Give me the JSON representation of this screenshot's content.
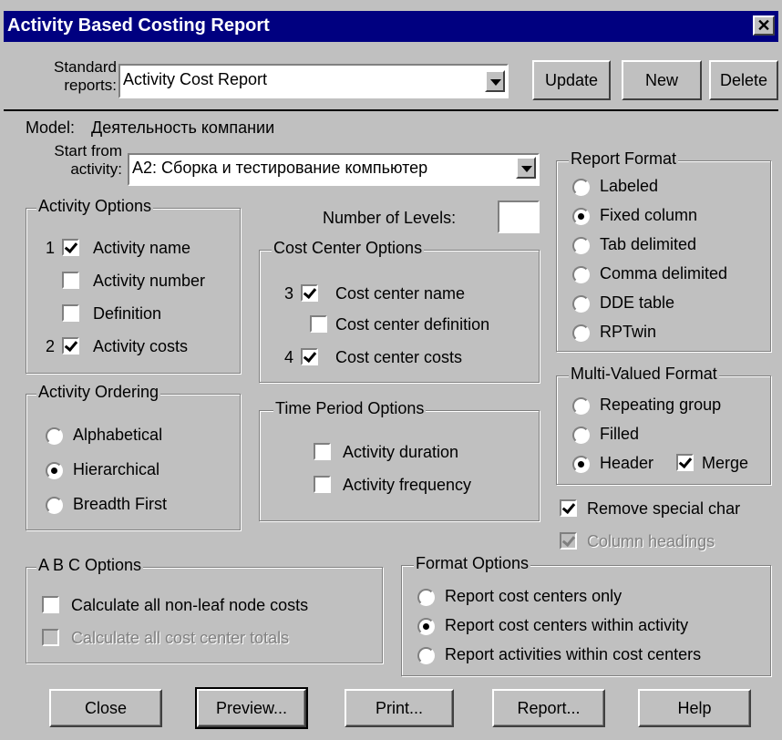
{
  "window": {
    "title": "Activity Based Costing Report",
    "close_label": "✕"
  },
  "header": {
    "standard_label_1": "Standard",
    "standard_label_2": "reports:",
    "report_value": "Activity Cost Report",
    "update": "Update",
    "new": "New",
    "delete": "Delete"
  },
  "model": {
    "label": "Model:",
    "value": "Деятельность компании"
  },
  "start": {
    "label_1": "Start from",
    "label_2": "activity:",
    "value": "A2:  Сборка и тестирование компьютер"
  },
  "levels": {
    "label": "Number of Levels:",
    "value": ""
  },
  "activity_options": {
    "title": "Activity Options",
    "items": [
      {
        "num": "1",
        "label": "Activity name",
        "checked": true
      },
      {
        "num": "",
        "label": "Activity number",
        "checked": false
      },
      {
        "num": "",
        "label": "Definition",
        "checked": false
      },
      {
        "num": "2",
        "label": "Activity costs",
        "checked": true
      }
    ]
  },
  "cost_center_options": {
    "title": "Cost Center Options",
    "items": [
      {
        "num": "3",
        "label": "Cost center name",
        "checked": true
      },
      {
        "num": "",
        "label": "Cost center definition",
        "checked": false
      },
      {
        "num": "4",
        "label": "Cost center costs",
        "checked": true
      }
    ]
  },
  "activity_ordering": {
    "title": "Activity Ordering",
    "items": [
      {
        "label": "Alphabetical",
        "selected": false
      },
      {
        "label": "Hierarchical",
        "selected": true
      },
      {
        "label": "Breadth First",
        "selected": false
      }
    ]
  },
  "time_period_options": {
    "title": "Time Period Options",
    "items": [
      {
        "label": "Activity duration",
        "checked": false
      },
      {
        "label": "Activity frequency",
        "checked": false
      }
    ]
  },
  "report_format": {
    "title": "Report Format",
    "items": [
      {
        "label": "Labeled",
        "selected": false
      },
      {
        "label": "Fixed column",
        "selected": true
      },
      {
        "label": "Tab delimited",
        "selected": false
      },
      {
        "label": "Comma delimited",
        "selected": false
      },
      {
        "label": "DDE table",
        "selected": false
      },
      {
        "label": "RPTwin",
        "selected": false
      }
    ]
  },
  "multi_valued_format": {
    "title": "Multi-Valued Format",
    "items": [
      {
        "label": "Repeating group",
        "selected": false
      },
      {
        "label": "Filled",
        "selected": false
      },
      {
        "label": "Header",
        "selected": true
      }
    ],
    "merge": {
      "label": "Merge",
      "checked": true
    }
  },
  "remove_special": {
    "label": "Remove special char",
    "checked": true
  },
  "column_headings": {
    "label": "Column headings",
    "checked": true,
    "disabled": true
  },
  "abc_options": {
    "title": "A B C  Options",
    "items": [
      {
        "label": "Calculate all non-leaf node costs",
        "checked": false,
        "disabled": false
      },
      {
        "label": "Calculate all cost center totals",
        "checked": false,
        "disabled": true
      }
    ]
  },
  "format_options": {
    "title": "Format Options",
    "items": [
      {
        "label": "Report cost centers only",
        "selected": false
      },
      {
        "label": "Report cost centers within activity",
        "selected": true
      },
      {
        "label": "Report activities within cost centers",
        "selected": false
      }
    ]
  },
  "footer": {
    "close": "Close",
    "preview": "Preview...",
    "print": "Print...",
    "report": "Report...",
    "help": "Help"
  }
}
